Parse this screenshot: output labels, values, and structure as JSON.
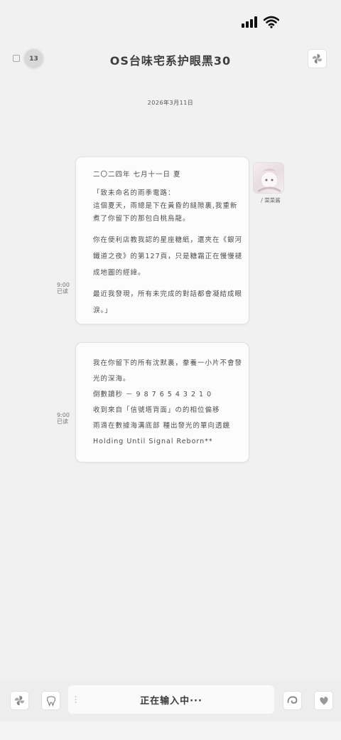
{
  "header": {
    "badge_count": "13",
    "title": "OS台味宅系护眼黑30"
  },
  "date_label": "2026年3月11日",
  "messages": [
    {
      "lines": [
        "二〇二四年  七月十一日  夏",
        "",
        "「致未命名的雨季電路：",
        "這個夏天，雨總是下在黃昏的縫隙裏,我重新",
        "煮了你留下的那包白桃烏龍。",
        "",
        "你在便利店教我認的星座糖紙，還夾在《銀河",
        "鐵道之夜》的第127頁，只是糖霜正在慢慢褪",
        "成地圖的經緯。",
        "",
        "最近我發現，所有未完成的對話都會凝結成眼",
        "淚。」"
      ],
      "time": "9:00",
      "status": "已读"
    },
    {
      "lines": [
        "我在你留下的所有沈默裏，豢養一小片不會發",
        "光的深海。",
        "倒數讀秒 － 9 8 7 6 5 4 3 2 1 0",
        "收到來自「信號塔背面」の的相位偏移",
        "雨滴在數據海溝底部  種出發光的單向透鏡",
        "Holding  Until  Signal  Reborn**"
      ],
      "time": "9:00",
      "status": "已读"
    }
  ],
  "contact": {
    "name": "/ 菜菜酱"
  },
  "input": {
    "status_text": "正在输入中···"
  },
  "icons": {
    "status_signal": "signal-icon",
    "status_wifi": "wifi-icon",
    "header_right": "pinwheel-icon",
    "bottom_left_1": "pinwheel-icon",
    "bottom_left_2": "tooth-icon",
    "bottom_right_1": "swirl-icon",
    "bottom_right_2": "heart-icon"
  }
}
